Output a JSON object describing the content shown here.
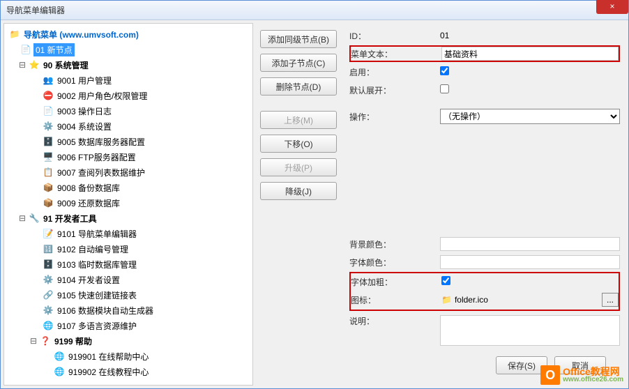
{
  "window": {
    "title": "导航菜单编辑器",
    "close": "×"
  },
  "tree": {
    "root": "导航菜单 (www.umvsoft.com)",
    "selected": "01 新节点",
    "group90": "90 系统管理",
    "n9001": "9001 用户管理",
    "n9002": "9002 用户角色/权限管理",
    "n9003": "9003 操作日志",
    "n9004": "9004 系统设置",
    "n9005": "9005 数据库服务器配置",
    "n9006": "9006 FTP服务器配置",
    "n9007": "9007 查阅列表数据维护",
    "n9008": "9008 备份数据库",
    "n9009": "9009 还原数据库",
    "group91": "91 开发者工具",
    "n9101": "9101 导航菜单编辑器",
    "n9102": "9102 自动编号管理",
    "n9103": "9103 临时数据库管理",
    "n9104": "9104 开发者设置",
    "n9105": "9105 快速创建链接表",
    "n9106": "9106 数据模块自动生成器",
    "n9107": "9107 多语言资源维护",
    "group9199": "9199 帮助",
    "n919901": "919901 在线帮助中心",
    "n919902": "919902 在线教程中心"
  },
  "buttons": {
    "add_sibling": "添加同级节点(B)",
    "add_child": "添加子节点(C)",
    "delete": "删除节点(D)",
    "move_up": "上移(M)",
    "move_down": "下移(O)",
    "promote": "升级(P)",
    "demote": "降级(J)"
  },
  "form": {
    "id_label": "ID：",
    "id_value": "01",
    "menu_text_label": "菜单文本：",
    "menu_text_value": "基础资料",
    "enable_label": "启用：",
    "enable_value": true,
    "expand_label": "默认展开：",
    "expand_value": false,
    "action_label": "操作：",
    "action_value": "（无操作）",
    "bgcolor_label": "背景颜色：",
    "bgcolor_value": "",
    "fontcolor_label": "字体颜色：",
    "fontcolor_value": "",
    "bold_label": "字体加粗：",
    "bold_value": true,
    "icon_label": "图标：",
    "icon_value": "folder.ico",
    "desc_label": "说明：",
    "desc_value": ""
  },
  "footer": {
    "save": "保存(S)",
    "cancel": "取消"
  },
  "watermark": {
    "brand": "Office教程网",
    "url": "www.office26.com"
  }
}
